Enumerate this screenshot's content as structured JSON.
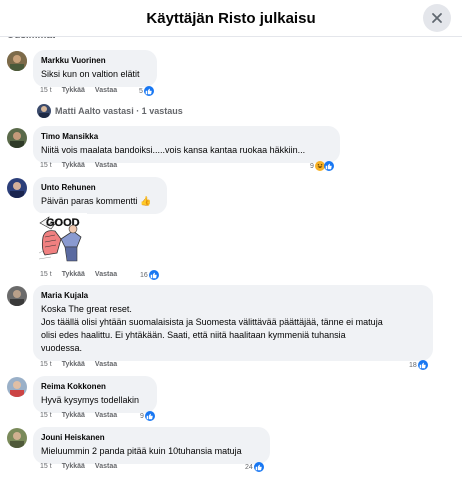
{
  "header": {
    "title": "Käyttäjän Risto julkaisu",
    "close_icon": "close-icon"
  },
  "cut_text": "Uusimmat",
  "comments": [
    {
      "author": "Markku Vuorinen",
      "text": [
        "Siksi kun on valtion elätit"
      ],
      "time": "15 t",
      "like": "Tykkää",
      "reply": "Vastaa",
      "reactions": "5"
    },
    {
      "author": "Timo Mansikka",
      "text": [
        "Niitä vois maalata bandoiksi.....vois kansa kantaa ruokaa häkkiin..."
      ],
      "time": "15 t",
      "like": "Tykkää",
      "reply": "Vastaa",
      "reactions": "9"
    },
    {
      "author": "Unto Rehunen",
      "text": [
        "Päivän paras kommentti 👍"
      ],
      "time": "15 t",
      "like": "Tykkää",
      "reply": "Vastaa",
      "reactions": "16",
      "sticker_text": "GOOD"
    },
    {
      "author": "Maria Kujala",
      "text": [
        "Koska The great reset.",
        "Jos täällä olisi yhtään suomalaisista ja Suomesta välittävää päättäjää, tänne ei matuja",
        "olisi edes haalittu. Ei yhtäkään. Saati, että niitä haalitaan kymmeniä tuhansia",
        "vuodessa."
      ],
      "time": "15 t",
      "like": "Tykkää",
      "reply": "Vastaa",
      "reactions": "18"
    },
    {
      "author": "Reima Kokkonen",
      "text": [
        "Hyvä kysymys todellakin"
      ],
      "time": "15 t",
      "like": "Tykkää",
      "reply": "Vastaa",
      "reactions": "9"
    },
    {
      "author": "Jouni Heiskanen",
      "text": [
        "Mieluummin 2 panda pitää kuin 10tuhansia matuja"
      ],
      "time": "15 t",
      "like": "Tykkää",
      "reply": "Vastaa",
      "reactions": "24"
    }
  ],
  "replies": {
    "text": "Matti Aalto vastasi · 1 vastaus"
  },
  "colors": {
    "accent": "#1877f2",
    "bubble": "#f0f2f5",
    "secondary_text": "#65676b"
  }
}
